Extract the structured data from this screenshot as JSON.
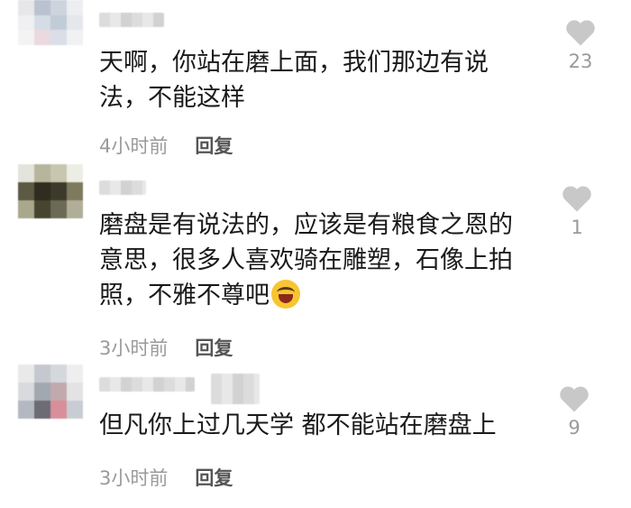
{
  "comments": [
    {
      "text": "天啊，你站在磨上面，我们那边有说法，不能这样",
      "time": "4小时前",
      "reply": "回复",
      "likes": "23",
      "like_icon": "heart-icon"
    },
    {
      "text": "磨盘是有说法的，应该是有粮食之恩的意思，很多人喜欢骑在雕塑，石像上拍照，不雅不尊吧",
      "emoji": "rofl-emoji",
      "time": "3小时前",
      "reply": "回复",
      "likes": "1",
      "like_icon": "heart-icon"
    },
    {
      "text": "但凡你上过几天学 都不能站在磨盘上",
      "time": "3小时前",
      "reply": "回复",
      "likes": "9",
      "like_icon": "heart-icon"
    }
  ],
  "colors": {
    "text": "#1a1a1a",
    "meta": "#9a9a9a",
    "heart": "#c8c8c8"
  }
}
